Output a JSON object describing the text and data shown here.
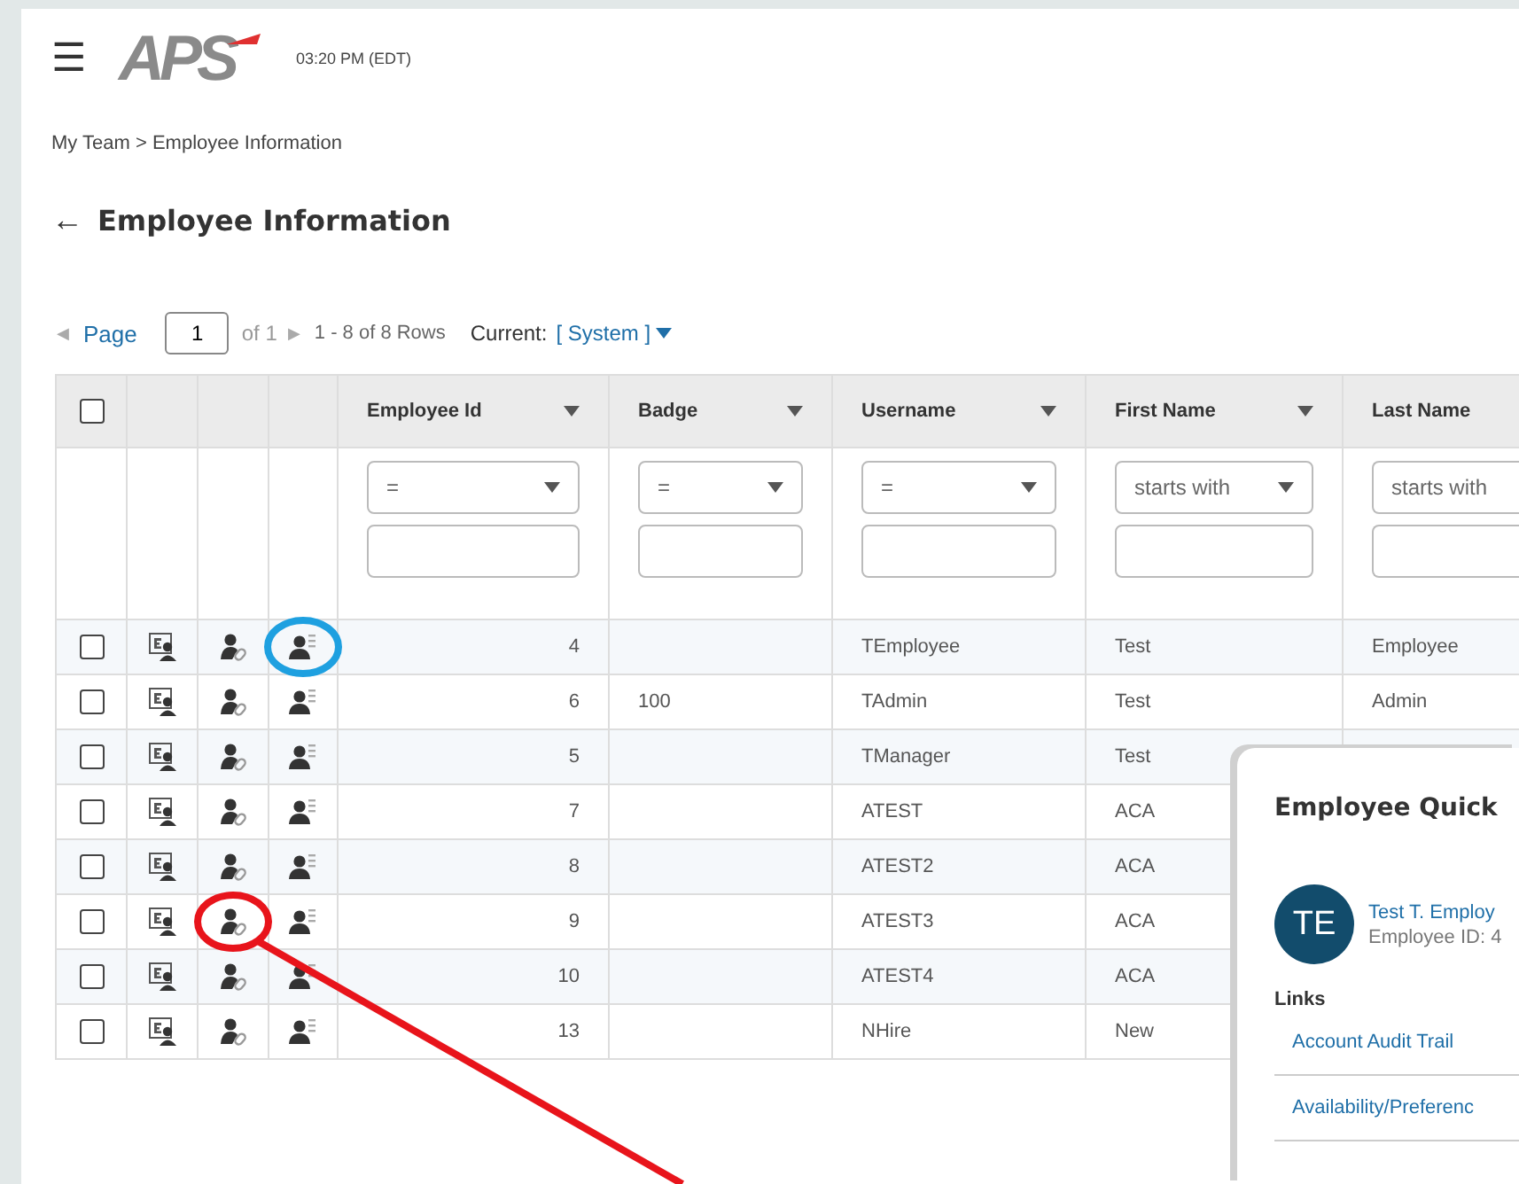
{
  "header": {
    "menu": "☰",
    "logo": "APS",
    "time": "03:20 PM (EDT)"
  },
  "breadcrumb": "My Team > Employee Information",
  "page_title": {
    "back": "←",
    "text": "Employee Information"
  },
  "pager": {
    "prev": "◀",
    "page_label": "Page",
    "page": "1",
    "of": "of 1",
    "next": "▶",
    "range": "1 - 8 of 8 Rows",
    "current_label": "Current:",
    "current": "[ System ]"
  },
  "table": {
    "select_all": {
      "checked": false
    },
    "columns": [
      {
        "label": "Employee Id",
        "filter": "="
      },
      {
        "label": "Badge",
        "filter": "="
      },
      {
        "label": "Username",
        "filter": "="
      },
      {
        "label": "First Name",
        "filter": "starts with"
      },
      {
        "label": "Last Name",
        "filter": "starts with"
      }
    ],
    "rows": [
      {
        "checked": false,
        "icons": [
          {
            "kind": "card"
          },
          {
            "kind": "person-link"
          },
          {
            "kind": "person-list",
            "circle": {
              "color": "#1ea0e0"
            }
          }
        ],
        "cells": [
          "4",
          "",
          "TEmployee",
          "Test",
          "Employee"
        ]
      },
      {
        "checked": false,
        "icons": [
          {
            "kind": "card"
          },
          {
            "kind": "person-link"
          },
          {
            "kind": "person-list"
          }
        ],
        "cells": [
          "6",
          "100",
          "TAdmin",
          "Test",
          "Admin"
        ]
      },
      {
        "checked": false,
        "icons": [
          {
            "kind": "card"
          },
          {
            "kind": "person-link"
          },
          {
            "kind": "person-list"
          }
        ],
        "cells": [
          "5",
          "",
          "TManager",
          "Test"
        ]
      },
      {
        "checked": false,
        "icons": [
          {
            "kind": "card"
          },
          {
            "kind": "person-link"
          },
          {
            "kind": "person-list"
          }
        ],
        "cells": [
          "7",
          "",
          "ATEST",
          "ACA"
        ]
      },
      {
        "checked": false,
        "icons": [
          {
            "kind": "card"
          },
          {
            "kind": "person-link"
          },
          {
            "kind": "person-list"
          }
        ],
        "cells": [
          "8",
          "",
          "ATEST2",
          "ACA"
        ]
      },
      {
        "checked": false,
        "icons": [
          {
            "kind": "card"
          },
          {
            "kind": "person-link",
            "circle": {
              "color": "#e8141b",
              "pointer": true
            }
          },
          {
            "kind": "person-list"
          }
        ],
        "cells": [
          "9",
          "",
          "ATEST3",
          "ACA"
        ]
      },
      {
        "checked": false,
        "icons": [
          {
            "kind": "card"
          },
          {
            "kind": "person-link"
          },
          {
            "kind": "person-list"
          }
        ],
        "cells": [
          "10",
          "",
          "ATEST4",
          "ACA"
        ]
      },
      {
        "checked": false,
        "icons": [
          {
            "kind": "card"
          },
          {
            "kind": "person-link"
          },
          {
            "kind": "person-list"
          }
        ],
        "cells": [
          "13",
          "",
          "NHire",
          "New"
        ]
      }
    ]
  },
  "quick_view": {
    "title": "Employee Quick",
    "initials": "TE",
    "name": "Test T. Employ",
    "detail": "Employee ID: 4",
    "links_label": "Links",
    "links": [
      "Account Audit Trail",
      "Availability/Preferenc"
    ]
  }
}
